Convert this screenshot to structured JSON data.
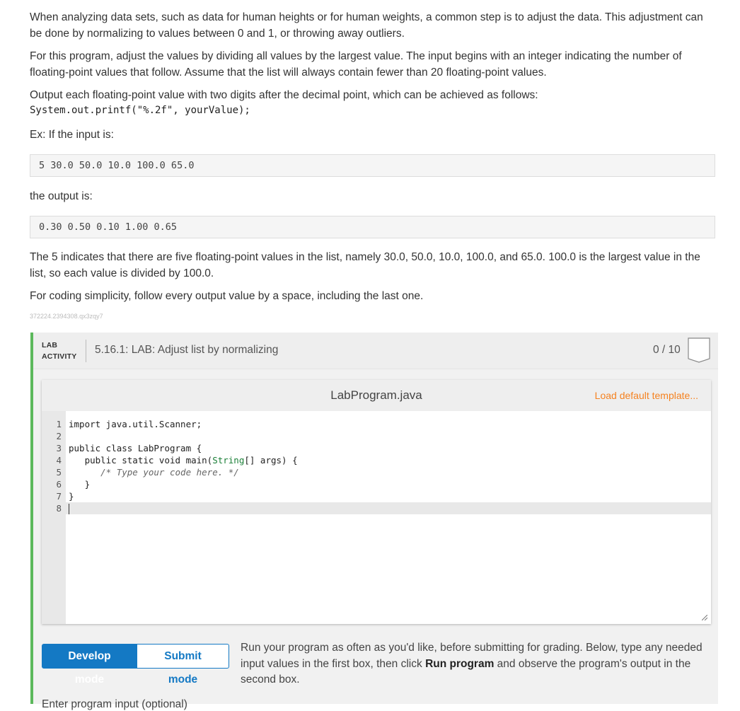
{
  "instructions": {
    "p1": "When analyzing data sets, such as data for human heights or for human weights, a common step is to adjust the data. This adjustment can be done by normalizing to values between 0 and 1, or throwing away outliers.",
    "p2": "For this program, adjust the values by dividing all values by the largest value. The input begins with an integer indicating the number of floating-point values that follow. Assume that the list will always contain fewer than 20 floating-point values.",
    "p3": "Output each floating-point value with two digits after the decimal point, which can be achieved as follows:",
    "code_snippet": "System.out.printf(\"%.2f\", yourValue);",
    "p4": "Ex: If the input is:",
    "example_input": "5 30.0 50.0 10.0 100.0 65.0",
    "p5": "the output is:",
    "example_output": "0.30 0.50 0.10 1.00 0.65",
    "p6": "The 5 indicates that there are five floating-point values in the list, namely 30.0, 50.0, 10.0, 100.0, and 65.0. 100.0 is the largest value in the list, so each value is divided by 100.0.",
    "p7": "For coding simplicity, follow every output value by a space, including the last one.",
    "tiny_id": "372224.2394308.qx3zqy7"
  },
  "lab": {
    "tag_line1": "LAB",
    "tag_line2": "ACTIVITY",
    "title": "5.16.1: LAB: Adjust list by normalizing",
    "score": "0 / 10",
    "accent_color": "#5cb85c"
  },
  "editor": {
    "file_name": "LabProgram.java",
    "load_template": "Load default template...",
    "lines": [
      {
        "num": "1",
        "text": "import java.util.Scanner;"
      },
      {
        "num": "2",
        "text": ""
      },
      {
        "num": "3",
        "text": "public class LabProgram {"
      },
      {
        "num": "4",
        "pre": "   public static void main(",
        "type": "String",
        "post": "[] args) {"
      },
      {
        "num": "5",
        "comment": "      /* Type your code here. */"
      },
      {
        "num": "6",
        "text": "   }"
      },
      {
        "num": "7",
        "text": "}"
      },
      {
        "num": "8",
        "text": ""
      }
    ],
    "active_line": 8
  },
  "modes": {
    "develop_label": "Develop mode",
    "submit_label": "Submit mode",
    "active": "develop",
    "help_before": "Run your program as often as you'd like, before submitting for grading. Below, type any needed input values in the first box, then click ",
    "help_bold": "Run program",
    "help_after": " and observe the program's output in the second box.",
    "accent_color": "#1479c4"
  },
  "cut_text": "Enter program input (optional)"
}
